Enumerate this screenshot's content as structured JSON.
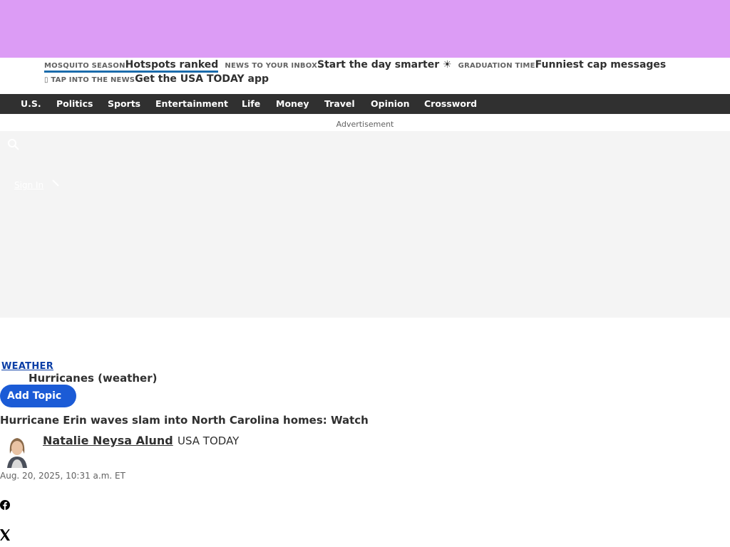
{
  "colors": {
    "top_ad": "#dc9cf5",
    "nav_bg": "#303030",
    "add_topic_bg": "#1b5bd6",
    "category_link": "#0b3ea6",
    "active_underline": "#1a6bab"
  },
  "trending": [
    {
      "kicker": "MOSQUITO SEASON",
      "headline": "Hotspots ranked"
    },
    {
      "kicker": "NEWS TO YOUR INBOX",
      "headline": "Start the day smarter ☀"
    },
    {
      "kicker": "GRADUATION TIME",
      "headline": "Funniest cap messages"
    },
    {
      "kicker": "TAP INTO THE NEWS",
      "headline": "Get the USA TODAY app"
    }
  ],
  "nav": {
    "items": [
      "U.S.",
      "Politics",
      "Sports",
      "Entertainment",
      "Life",
      "Money",
      "Travel",
      "Opinion",
      "Crossword"
    ]
  },
  "advertisement_label": "Advertisement",
  "header_tools": {
    "sign_in": "Sign In",
    "icons": [
      "eye-icon",
      "search-icon",
      "pencil-icon"
    ]
  },
  "article": {
    "category": "WEATHER",
    "topic": "Hurricanes (weather)",
    "add_topic_label": "Add Topic",
    "headline": "Hurricane Erin waves slam into North Carolina homes: Watch",
    "author": "Natalie Neysa Alund",
    "outlet": "USA TODAY",
    "timestamp": "Aug. 20, 2025, 10:31 a.m. ET"
  },
  "share_icons": [
    "facebook-icon",
    "x-icon"
  ]
}
